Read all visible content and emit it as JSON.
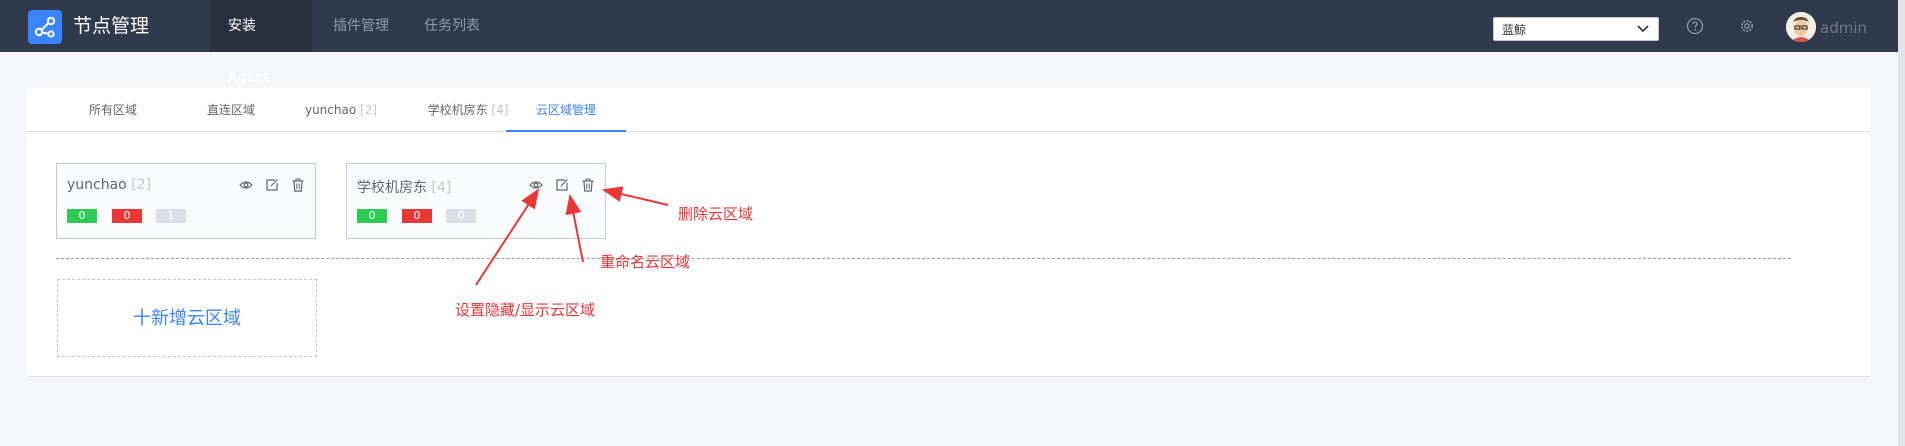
{
  "header": {
    "app_title": "节点管理",
    "nav": [
      {
        "label": "安装Agent",
        "active": true
      },
      {
        "label": "插件管理",
        "active": false
      },
      {
        "label": "任务列表",
        "active": false
      }
    ],
    "business_select": "蓝鲸",
    "help_icon": "help-circle-icon",
    "settings_icon": "gear-icon",
    "user": "admin"
  },
  "tabs": [
    {
      "label": "所有区域",
      "count": ""
    },
    {
      "label": "直连区域",
      "count": ""
    },
    {
      "label": "yunchao",
      "count": "[2]"
    },
    {
      "label": "学校机房东",
      "count": "[4]"
    },
    {
      "label": "云区域管理",
      "count": "",
      "active": true
    }
  ],
  "cards": [
    {
      "name": "yunchao",
      "count": "[2]",
      "normal": "0",
      "abnormal": "0",
      "not_installed": "1"
    },
    {
      "name": "学校机房东",
      "count": "[4]",
      "normal": "0",
      "abnormal": "0",
      "not_installed": "0"
    }
  ],
  "add_cloud_area": "十新增云区域",
  "annotations": {
    "delete": "删除云区域",
    "rename": "重命名云区域",
    "toggle_visibility": "设置隐藏/显示云区域"
  },
  "colors": {
    "header_bg": "#303a4d",
    "accent": "#3a84ff",
    "success": "#2dcb56",
    "danger": "#ea3636",
    "annotation": "#ea3636"
  }
}
